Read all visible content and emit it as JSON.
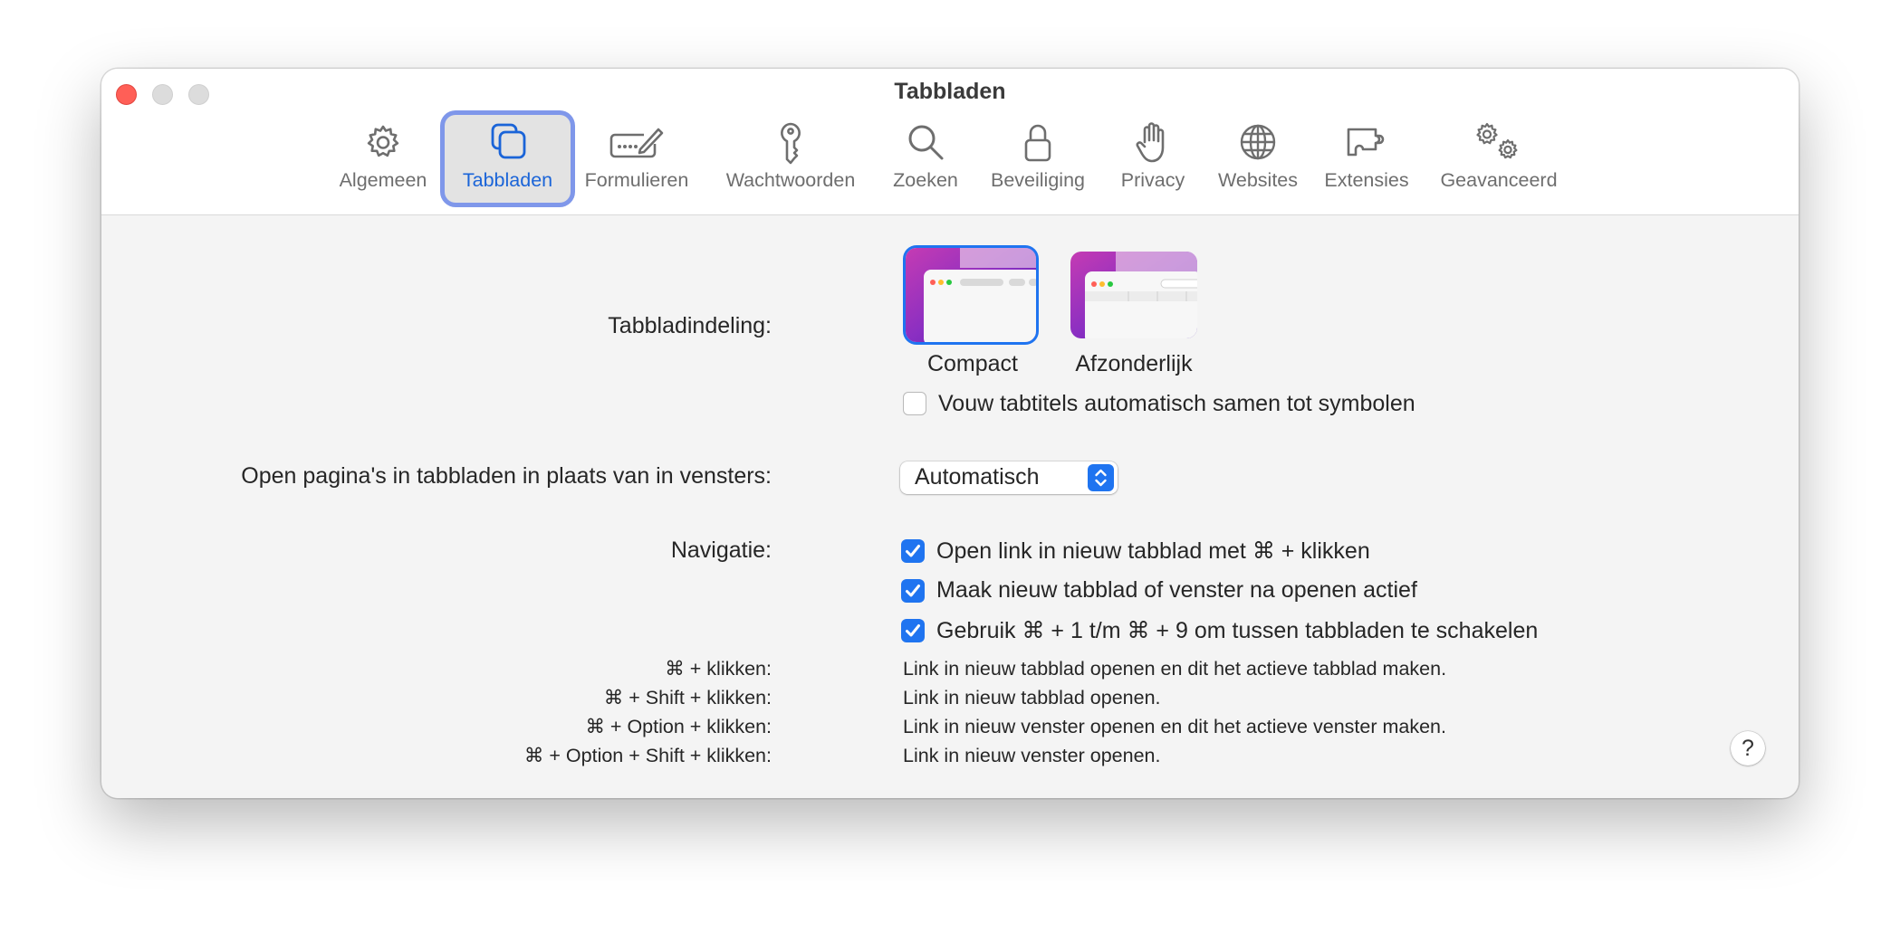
{
  "window": {
    "title": "Tabbladen"
  },
  "toolbar": {
    "tabs": [
      {
        "label": "Algemeen",
        "icon": "gear-icon"
      },
      {
        "label": "Tabbladen",
        "icon": "tabs-icon",
        "selected": true
      },
      {
        "label": "Formulieren",
        "icon": "form-pencil-icon"
      },
      {
        "label": "Wachtwoorden",
        "icon": "key-icon"
      },
      {
        "label": "Zoeken",
        "icon": "magnifier-icon"
      },
      {
        "label": "Beveiliging",
        "icon": "lock-icon"
      },
      {
        "label": "Privacy",
        "icon": "hand-icon"
      },
      {
        "label": "Websites",
        "icon": "globe-icon"
      },
      {
        "label": "Extensies",
        "icon": "puzzle-icon"
      },
      {
        "label": "Geavanceerd",
        "icon": "gears-icon"
      }
    ]
  },
  "layout": {
    "label": "Tabbladindeling:",
    "options": [
      {
        "label": "Compact",
        "selected": true
      },
      {
        "label": "Afzonderlijk",
        "selected": false
      }
    ],
    "collapse_checkbox": {
      "label": "Vouw tabtitels automatisch samen tot symbolen",
      "checked": false
    }
  },
  "open_pages": {
    "label": "Open pagina's in tabbladen in plaats van in vensters:",
    "value": "Automatisch"
  },
  "navigation": {
    "label": "Navigatie:",
    "checkboxes": [
      {
        "label": "Open link in nieuw tabblad met ⌘ + klikken",
        "checked": true
      },
      {
        "label": "Maak nieuw tabblad of venster na openen actief",
        "checked": true
      },
      {
        "label": "Gebruik ⌘ + 1 t/m ⌘ + 9 om tussen tabbladen te schakelen",
        "checked": true
      }
    ]
  },
  "shortcuts": [
    {
      "keys": "⌘ + klikken:",
      "desc": "Link in nieuw tabblad openen en dit het actieve tabblad maken."
    },
    {
      "keys": "⌘ + Shift + klikken:",
      "desc": "Link in nieuw tabblad openen."
    },
    {
      "keys": "⌘ + Option + klikken:",
      "desc": "Link in nieuw venster openen en dit het actieve venster maken."
    },
    {
      "keys": "⌘ + Option + Shift + klikken:",
      "desc": "Link in nieuw venster openen."
    }
  ],
  "help": {
    "label": "?"
  },
  "colors": {
    "accent": "#1f74f0",
    "selection_ring": "#7f97ea",
    "close": "#ff5f57"
  }
}
